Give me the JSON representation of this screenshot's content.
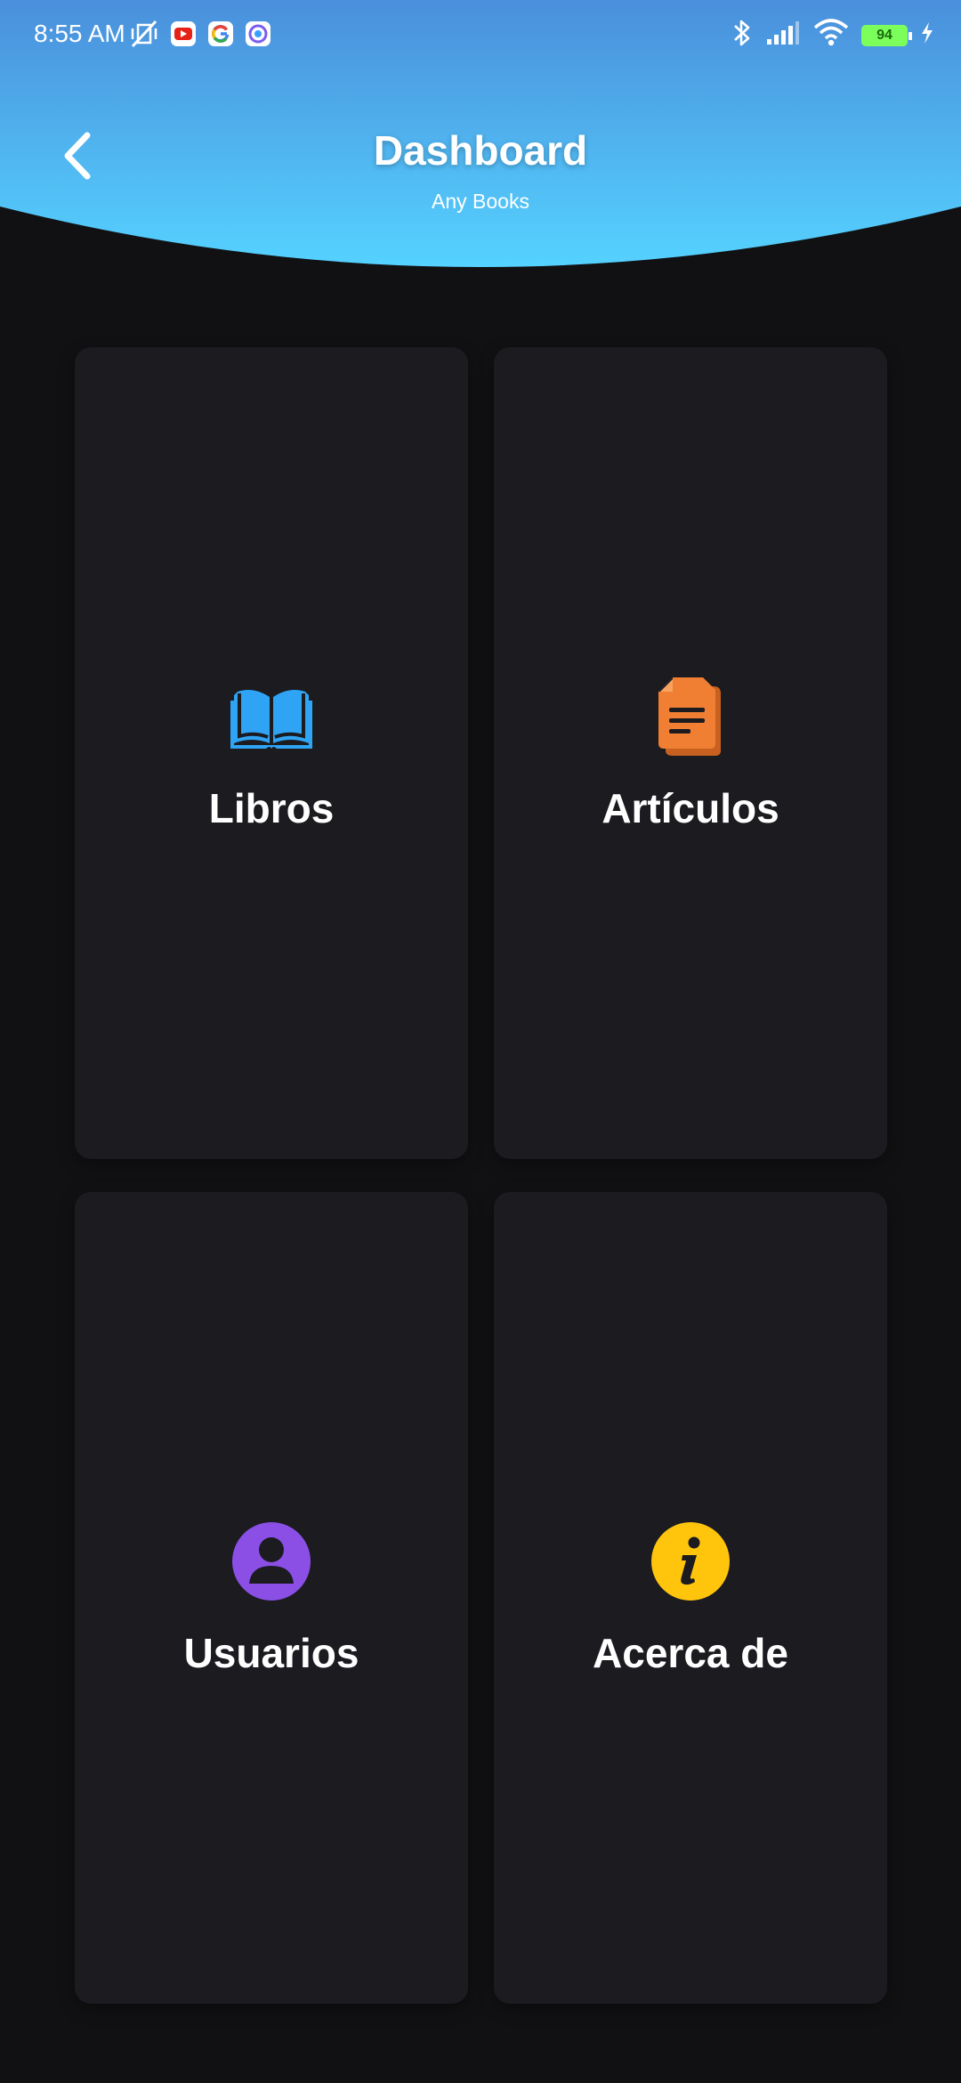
{
  "status_bar": {
    "time": "8:55 AM",
    "battery": "94"
  },
  "header": {
    "title": "Dashboard",
    "subtitle": "Any Books"
  },
  "cards": [
    {
      "label": "Libros",
      "icon": "open-book-icon",
      "color": "#2FA4F4"
    },
    {
      "label": "Artículos",
      "icon": "document-icon",
      "color": "#F07F34"
    },
    {
      "label": "Usuarios",
      "icon": "user-icon",
      "color": "#8B4FE6"
    },
    {
      "label": "Acerca de",
      "icon": "info-icon",
      "color": "#FFC40C"
    }
  ],
  "colors": {
    "header_top": "#4A8FDB",
    "header_bottom": "#52CFFF",
    "background": "#111113",
    "card": "#1b1b20"
  }
}
